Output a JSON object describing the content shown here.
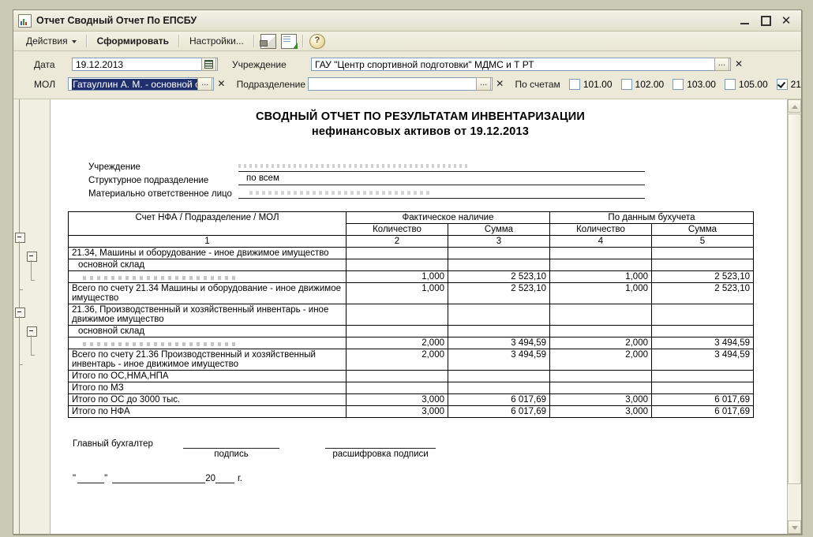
{
  "window": {
    "title": "Отчет  Сводный Отчет По ЕПСБУ",
    "icon": "report-chart-icon",
    "minimize": "—",
    "maximize": "□",
    "close": "✕"
  },
  "toolbar": {
    "actions": "Действия",
    "generate": "Сформировать",
    "settings": "Настройки...",
    "icons": [
      "print-icon",
      "save-to-file-icon",
      "help-icon"
    ],
    "help_glyph": "?"
  },
  "params": {
    "date_label": "Дата",
    "date_value": "19.12.2013",
    "date_picker_icon": "calendar-icon",
    "institution_label": "Учреждение",
    "institution_value": "ГАУ \"Центр спортивной подготовки\" МДМС и Т РТ",
    "mol_label": "МОЛ",
    "mol_value": "Гатауллин А. М. - основной склад",
    "subdivision_label": "Подразделение",
    "subdivision_value": "",
    "ellipsis": "...",
    "clear": "✕",
    "accounts_label": "По счетам",
    "accounts": [
      {
        "label": "101.00",
        "checked": false
      },
      {
        "label": "102.00",
        "checked": false
      },
      {
        "label": "103.00",
        "checked": false
      },
      {
        "label": "105.00",
        "checked": false
      },
      {
        "label": "21",
        "checked": true
      }
    ]
  },
  "report": {
    "title_line1": "СВОДНЫЙ ОТЧЕТ ПО РЕЗУЛЬТАТАМ ИНВЕНТАРИЗАЦИИ",
    "title_line2": "нефинансовых активов от 19.12.2013",
    "meta": [
      {
        "label": "Учреждение",
        "value": ""
      },
      {
        "label": "Структурное подразделение",
        "value": "по всем"
      },
      {
        "label": "Материально ответственное лицо",
        "value": ""
      }
    ],
    "headers": {
      "col1": "Счет НФА / Подразделение / МОЛ",
      "group_fact": "Фактическое наличие",
      "group_acct": "По данным бухучета",
      "qty": "Количество",
      "sum": "Сумма",
      "numbers": [
        "1",
        "2",
        "3",
        "4",
        "5"
      ]
    },
    "rows": [
      {
        "type": "group",
        "name": "21.34, Машины и оборудование - иное движимое имущество",
        "qty_fact": "",
        "sum_fact": "",
        "qty_acct": "",
        "sum_acct": ""
      },
      {
        "type": "sub",
        "name": "основной склад",
        "qty_fact": "",
        "sum_fact": "",
        "qty_acct": "",
        "sum_acct": ""
      },
      {
        "type": "blurred",
        "name": "",
        "qty_fact": "1,000",
        "sum_fact": "2 523,10",
        "qty_acct": "1,000",
        "sum_acct": "2 523,10"
      },
      {
        "type": "total",
        "name": "Всего по счету 21.34 Машины и оборудование - иное движимое имущество",
        "qty_fact": "1,000",
        "sum_fact": "2 523,10",
        "qty_acct": "1,000",
        "sum_acct": "2 523,10"
      },
      {
        "type": "group",
        "name": "21.36, Производственный и хозяйственный инвентарь - иное движимое имущество",
        "qty_fact": "",
        "sum_fact": "",
        "qty_acct": "",
        "sum_acct": ""
      },
      {
        "type": "sub",
        "name": "основной склад",
        "qty_fact": "",
        "sum_fact": "",
        "qty_acct": "",
        "sum_acct": ""
      },
      {
        "type": "blurred",
        "name": "",
        "qty_fact": "2,000",
        "sum_fact": "3 494,59",
        "qty_acct": "2,000",
        "sum_acct": "3 494,59"
      },
      {
        "type": "total",
        "name": "Всего по счету 21.36 Производственный и хозяйственный инвентарь - иное движимое имущество",
        "qty_fact": "2,000",
        "sum_fact": "3 494,59",
        "qty_acct": "2,000",
        "sum_acct": "3 494,59"
      },
      {
        "type": "total",
        "name": "Итого по ОС,НМА,НПА",
        "qty_fact": "",
        "sum_fact": "",
        "qty_acct": "",
        "sum_acct": ""
      },
      {
        "type": "total",
        "name": "Итого по МЗ",
        "qty_fact": "",
        "sum_fact": "",
        "qty_acct": "",
        "sum_acct": ""
      },
      {
        "type": "total",
        "name": "Итого по ОС до 3000 тыс.",
        "qty_fact": "3,000",
        "sum_fact": "6 017,69",
        "qty_acct": "3,000",
        "sum_acct": "6 017,69"
      },
      {
        "type": "total",
        "name": "Итого по НФА",
        "qty_fact": "3,000",
        "sum_fact": "6 017,69",
        "qty_acct": "3,000",
        "sum_acct": "6 017,69"
      }
    ],
    "signature": {
      "role": "Главный бухгалтер",
      "caption_sign": "подпись",
      "caption_name": "расшифровка подписи",
      "date_quote_open": "\"",
      "date_quote_close": "\"",
      "year_prefix": "20",
      "year_suffix": "г."
    }
  }
}
